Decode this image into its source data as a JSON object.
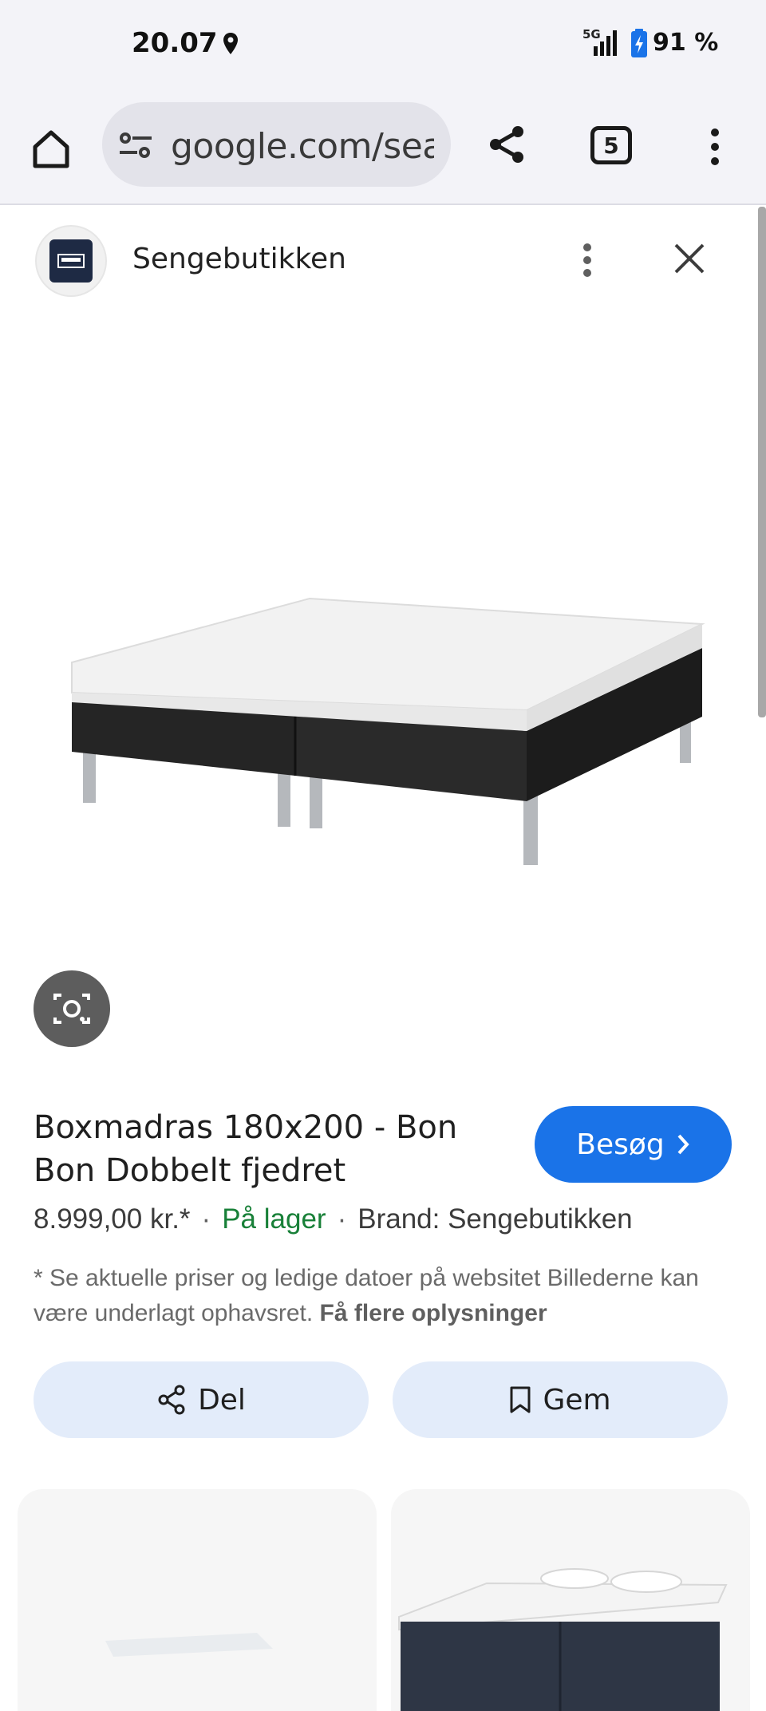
{
  "status_bar": {
    "time": "20.07",
    "network": "5G",
    "battery": "91 %"
  },
  "browser": {
    "url": "google.com/search",
    "tab_count": "5"
  },
  "source": {
    "name": "Sengebutikken"
  },
  "product": {
    "title": "Boxmadras 180x200 - Bon Bon Dobbelt fjedret",
    "visit_label": "Besøg",
    "price": "8.999,00 kr.*",
    "availability": "På lager",
    "brand": "Brand: Sengebutikken",
    "separator": "·",
    "disclaimer": "* Se aktuelle priser og ledige datoer på websitet Billederne kan være underlagt ophavsret.",
    "more_info": "Få flere oplysninger"
  },
  "actions": {
    "share_label": "Del",
    "save_label": "Gem"
  },
  "icons": {
    "home": "home-icon",
    "tune": "tune-icon",
    "share": "share-icon",
    "menu": "more-vert-icon",
    "close": "close-icon",
    "lens": "lens-icon",
    "bookmark": "bookmark-icon",
    "chevron": "chevron-right-icon"
  },
  "colors": {
    "accent": "#1a73e8",
    "in_stock": "#188038",
    "action_bg": "#e3ecfa",
    "chrome_bg": "#f3f3f8"
  }
}
